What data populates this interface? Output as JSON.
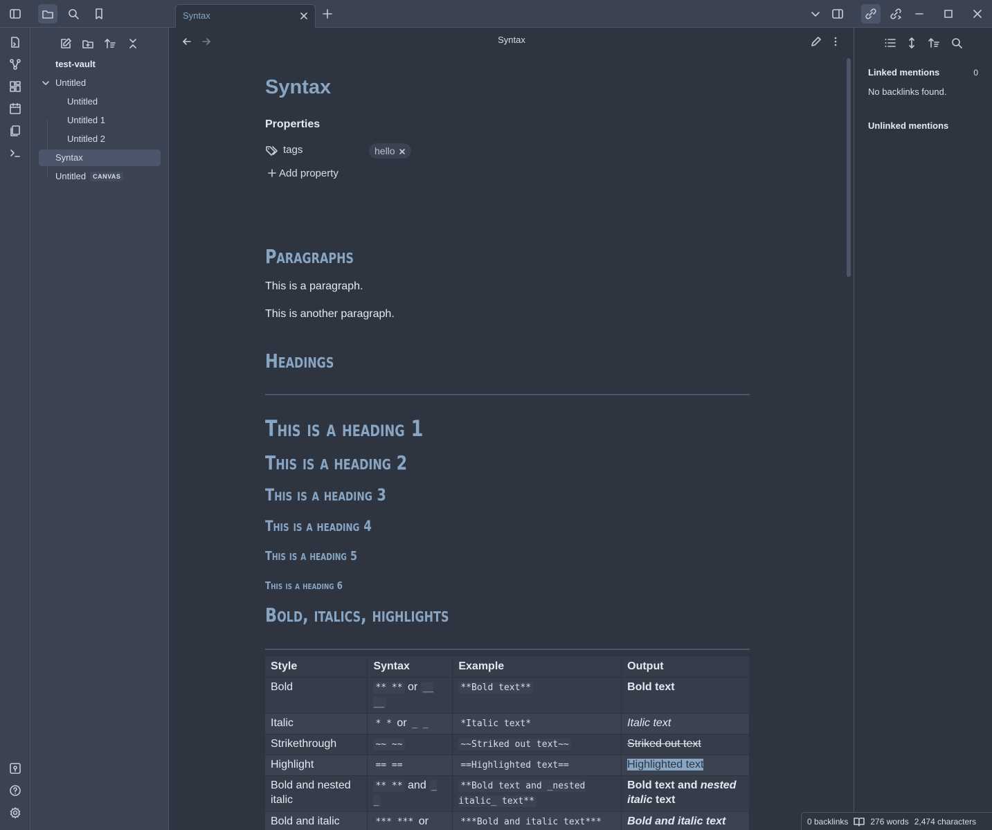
{
  "titlebar": {
    "tab_label": "Syntax",
    "icons": [
      "sidebar-toggle-icon",
      "folder-icon",
      "search-icon",
      "bookmark-icon",
      "new-tab-icon",
      "chevron-down-icon",
      "split-view-icon",
      "backlinks-icon",
      "outgoing-links-icon",
      "minimize-icon",
      "maximize-icon",
      "close-icon"
    ]
  },
  "ribbon": {
    "icons": [
      "open-quick-switcher-icon",
      "graph-view-icon",
      "canvas-icon",
      "daily-note-icon",
      "templates-icon",
      "command-palette-icon",
      "vault-switch-icon",
      "help-icon",
      "settings-icon"
    ]
  },
  "explorer": {
    "vault_name": "test-vault",
    "folder": "Untitled",
    "children": [
      "Untitled",
      "Untitled 1",
      "Untitled 2"
    ],
    "syntax": "Syntax",
    "canvas_name": "Untitled",
    "canvas_badge": "CANVAS"
  },
  "editor": {
    "header_title": "Syntax",
    "doc_title": "Syntax",
    "properties_label": "Properties",
    "property_key": "tags",
    "property_value": "hello",
    "add_property": "Add property",
    "h_paragraphs": "Paragraphs",
    "para1": "This is a paragraph.",
    "para2": "This is another paragraph.",
    "h_headings": "Headings",
    "h1": "This is a heading 1",
    "h2": "This is a heading 2",
    "h3": "This is a heading 3",
    "h4": "This is a heading 4",
    "h5": "This is a heading 5",
    "h6": "This is a heading 6",
    "h_bold": "Bold, italics, highlights"
  },
  "table": {
    "headers": [
      "Style",
      "Syntax",
      "Example",
      "Output"
    ],
    "rows": [
      {
        "style": "Bold",
        "syntax_a": "** **",
        "syntax_join": "or",
        "syntax_b": "__ __",
        "example": "**Bold text**",
        "output": "Bold text"
      },
      {
        "style": "Italic",
        "syntax_a": "* *",
        "syntax_join": "or",
        "syntax_b": "_ _",
        "example": "*Italic text*",
        "output": "Italic text"
      },
      {
        "style": "Strikethrough",
        "syntax_a": "~~ ~~",
        "example": "~~Striked out text~~",
        "output": "Striked out text"
      },
      {
        "style": "Highlight",
        "syntax_a": "== ==",
        "example": "==Highlighted text==",
        "output": "Highlighted text"
      },
      {
        "style": "Bold and nested italic",
        "syntax_a": "** **",
        "syntax_join": "and",
        "syntax_b": "_ _",
        "example": "**Bold text and _nested italic_ text**",
        "output_a": "Bold text and ",
        "output_b": "nested italic",
        "output_c": " text"
      },
      {
        "style": "Bold and italic",
        "syntax_a": "*** ***",
        "syntax_join": "or",
        "example": "***Bold and italic text***",
        "output": "Bold and italic text"
      }
    ]
  },
  "rightbar": {
    "linked_mentions": "Linked mentions",
    "linked_count": "0",
    "no_backlinks": "No backlinks found.",
    "unlinked_mentions": "Unlinked mentions"
  },
  "status": {
    "backlinks": "0 backlinks",
    "words": "276 words",
    "characters": "2,474 characters"
  }
}
